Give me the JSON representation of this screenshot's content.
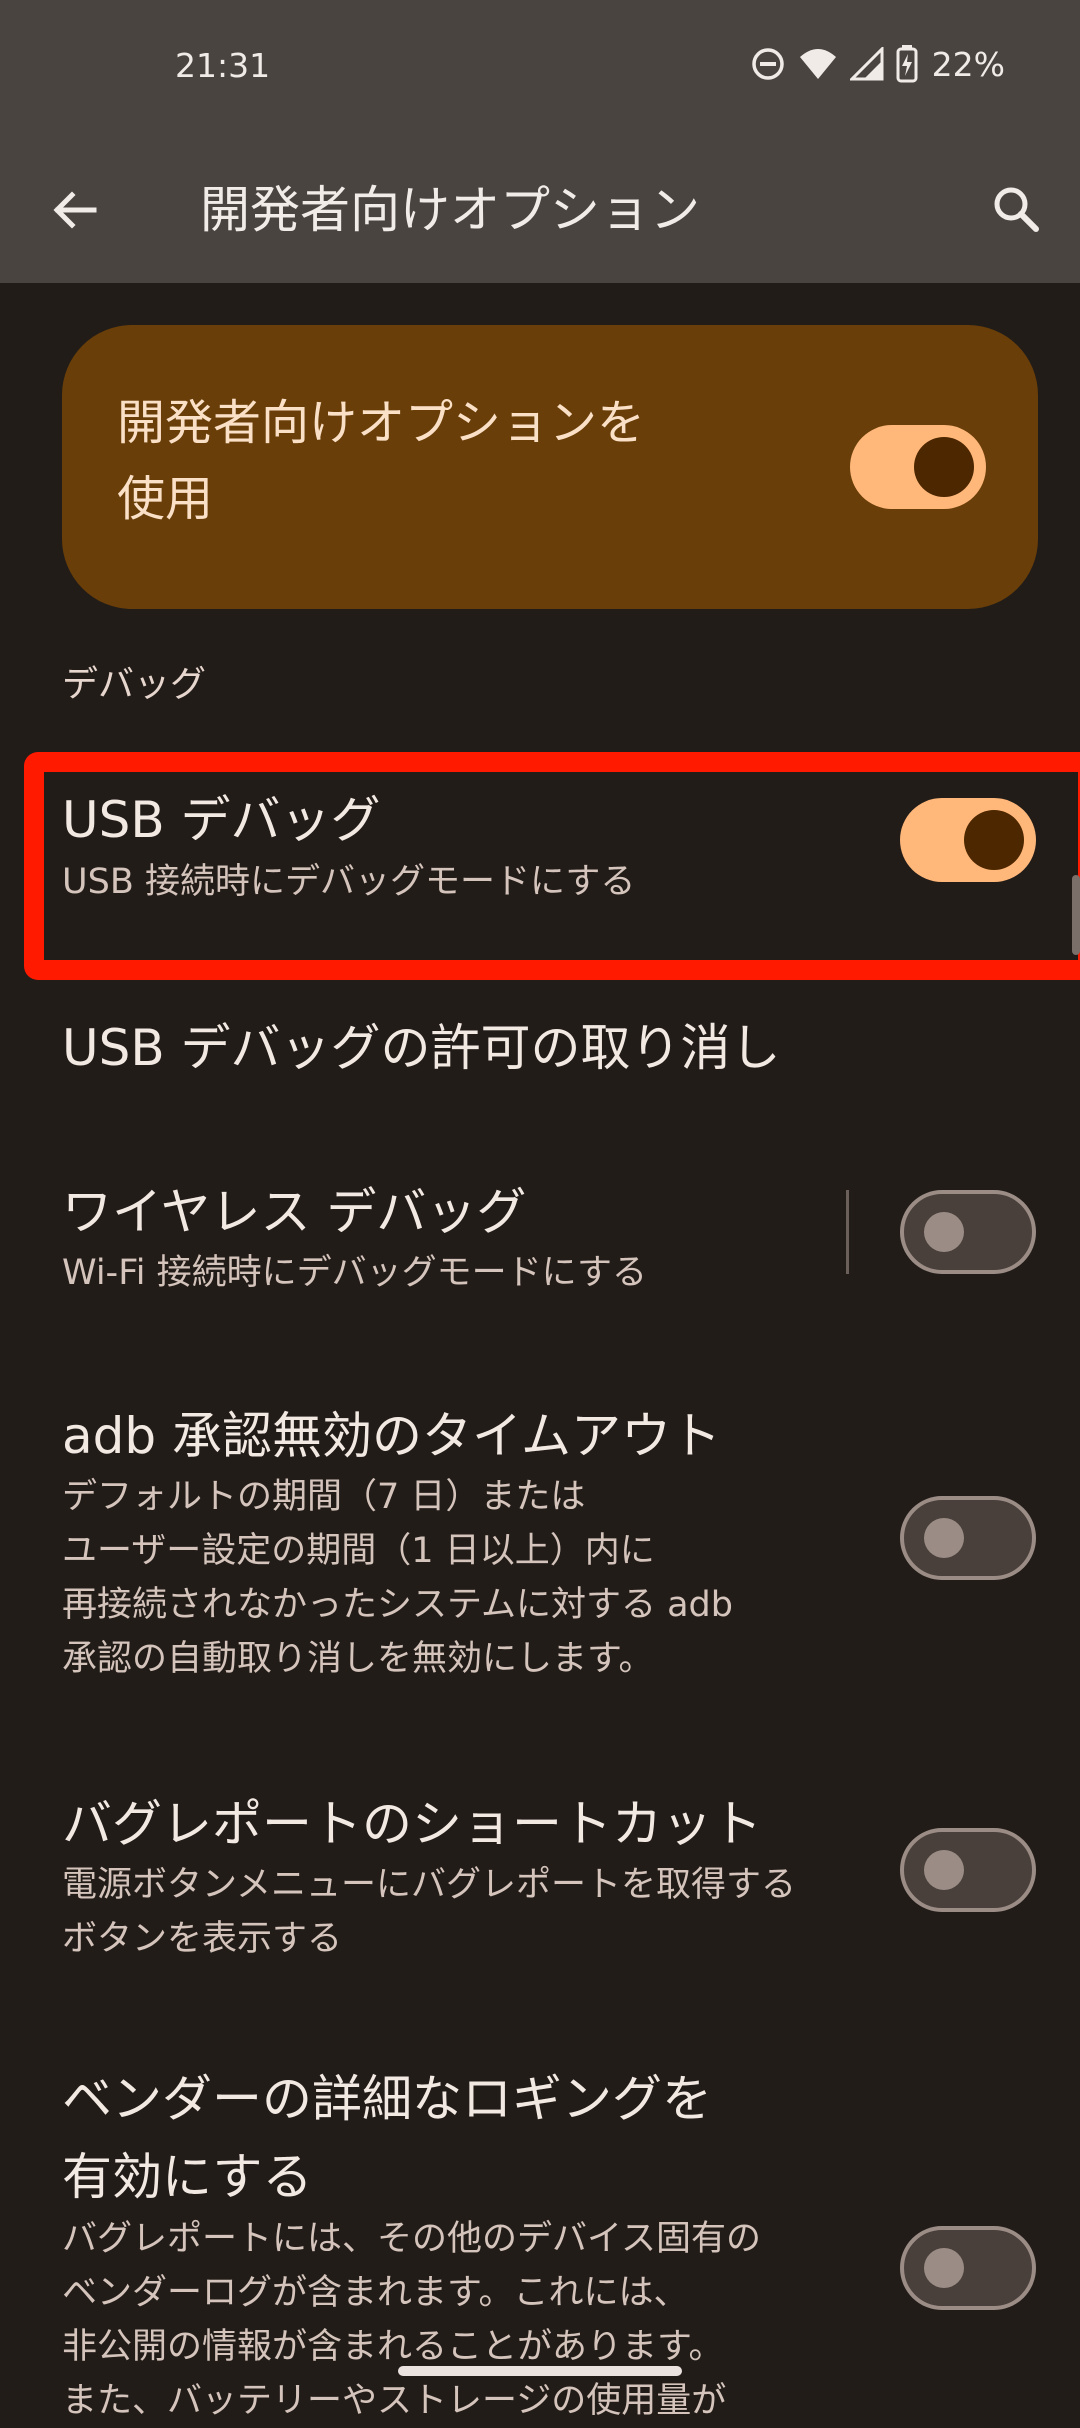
{
  "status_bar": {
    "time": "21:31",
    "battery": "22%",
    "icons": [
      "dnd-icon",
      "wifi-icon",
      "signal-icon",
      "battery-charging-icon"
    ]
  },
  "app_bar": {
    "title": "開発者向けオプション",
    "back_icon": "arrow-back-icon",
    "search_icon": "search-icon"
  },
  "master": {
    "label_line1": "開発者向けオプションを",
    "label_line2": "使用",
    "enabled": true
  },
  "section": {
    "debug_header": "デバッグ"
  },
  "prefs": {
    "usb_debug": {
      "title": "USB デバッグ",
      "summary": "USB 接続時にデバッグモードにする",
      "enabled": true
    },
    "revoke": {
      "title": "USB デバッグの許可の取り消し"
    },
    "wireless": {
      "title": "ワイヤレス デバッグ",
      "summary": "Wi-Fi 接続時にデバッグモードにする",
      "enabled": false
    },
    "adb_timeout": {
      "title": "adb 承認無効のタイムアウト",
      "summary_lines": [
        "デフォルトの期間（7 日）または",
        "ユーザー設定の期間（1 日以上）内に",
        "再接続されなかったシステムに対する adb",
        "承認の自動取り消しを無効にします。"
      ],
      "enabled": false
    },
    "bugreport": {
      "title": "バグレポートのショートカット",
      "summary_lines": [
        "電源ボタンメニューにバグレポートを取得する",
        "ボタンを表示する"
      ],
      "enabled": false
    },
    "vendor_logging": {
      "title_lines": [
        "ベンダーの詳細なロギングを",
        "有効にする"
      ],
      "summary_lines": [
        "バグレポートには、その他のデバイス固有の",
        "ベンダーログが含まれます。これには、",
        "非公開の情報が含まれることがあります。",
        "また、バッテリーやストレージの使用量が"
      ],
      "enabled": false
    }
  },
  "colors": {
    "background": "#221c19",
    "app_bar": "#4a4441",
    "master_card": "#693e08",
    "toggle_on_track": "#ffb77a",
    "highlight": "#ff1a00"
  }
}
